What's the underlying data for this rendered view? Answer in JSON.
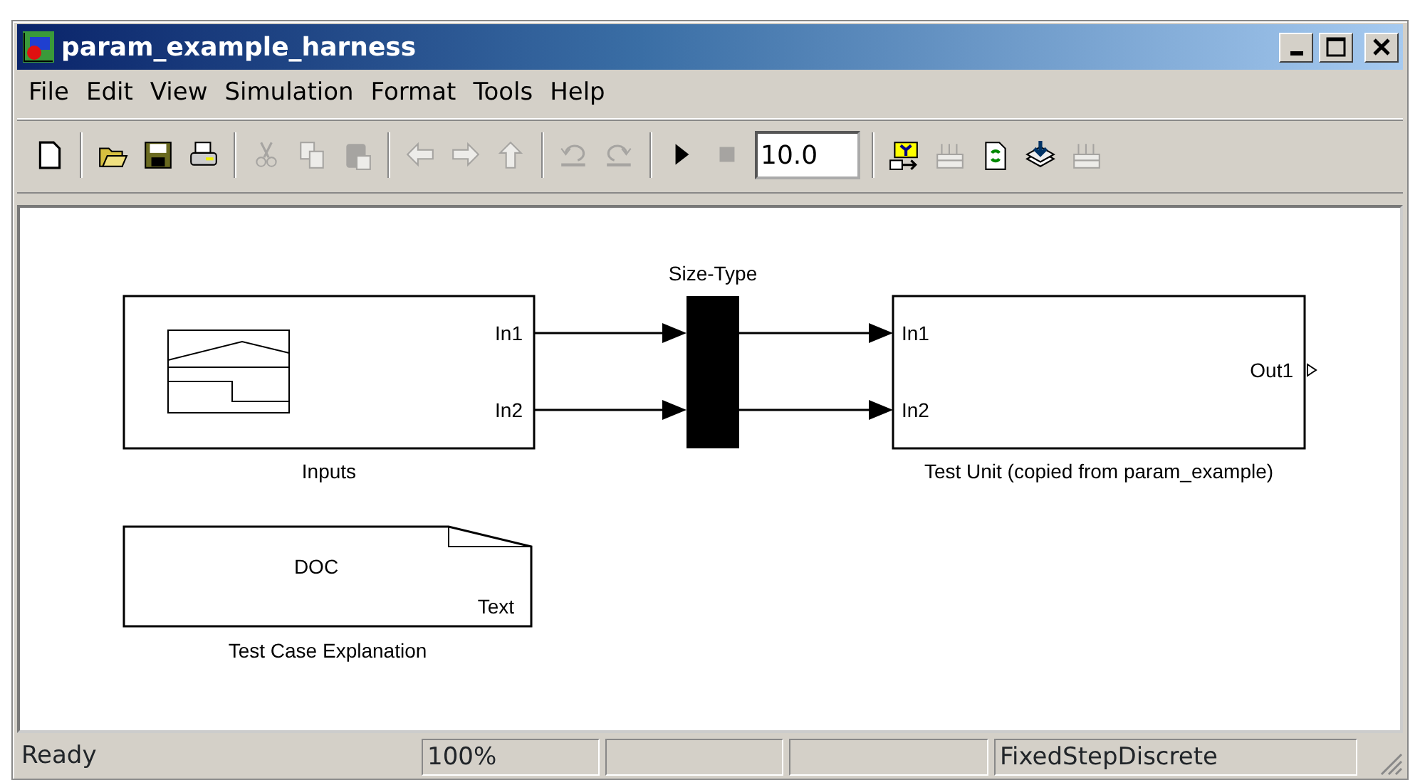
{
  "window": {
    "title": "param_example_harness"
  },
  "menu": [
    "File",
    "Edit",
    "View",
    "Simulation",
    "Format",
    "Tools",
    "Help"
  ],
  "toolbar": [
    {
      "kind": "new",
      "disabled": false
    },
    {
      "kind": "separator"
    },
    {
      "kind": "open",
      "disabled": false
    },
    {
      "kind": "save",
      "disabled": false
    },
    {
      "kind": "print",
      "disabled": false
    },
    {
      "kind": "separator"
    },
    {
      "kind": "cut",
      "disabled": true
    },
    {
      "kind": "copy",
      "disabled": true
    },
    {
      "kind": "paste",
      "disabled": true
    },
    {
      "kind": "separator"
    },
    {
      "kind": "back",
      "disabled": true
    },
    {
      "kind": "forward",
      "disabled": true
    },
    {
      "kind": "up",
      "disabled": true
    },
    {
      "kind": "separator"
    },
    {
      "kind": "undo",
      "disabled": true
    },
    {
      "kind": "redo",
      "disabled": true
    },
    {
      "kind": "separator"
    },
    {
      "kind": "play",
      "disabled": false
    },
    {
      "kind": "stop",
      "disabled": true
    },
    {
      "kind": "field",
      "value": "10.0"
    },
    {
      "kind": "separator"
    },
    {
      "kind": "build",
      "disabled": false
    },
    {
      "kind": "grid",
      "disabled": true
    },
    {
      "kind": "refresh",
      "disabled": false
    },
    {
      "kind": "layers",
      "disabled": false
    },
    {
      "kind": "grid",
      "disabled": true
    }
  ],
  "diagram": {
    "blocks": [
      {
        "kind": "signal-builder",
        "name": "Inputs",
        "outputs": [
          "In1",
          "In2"
        ]
      },
      {
        "kind": "bus",
        "name": "Size-Type"
      },
      {
        "kind": "subsystem",
        "name": "Test Unit (copied from param_example)",
        "inputs": [
          "In1",
          "In2"
        ],
        "outputs": [
          "Out1"
        ]
      },
      {
        "kind": "doc",
        "name": "Test Case Explanation",
        "title": "DOC",
        "caption": "Text"
      }
    ]
  },
  "status_bar": [
    {
      "kind": "text",
      "text": "Ready"
    },
    {
      "kind": "text",
      "text": "100%"
    },
    {
      "kind": "blank"
    },
    {
      "kind": "blank"
    },
    {
      "kind": "text",
      "text": "FixedStepDiscrete"
    }
  ]
}
